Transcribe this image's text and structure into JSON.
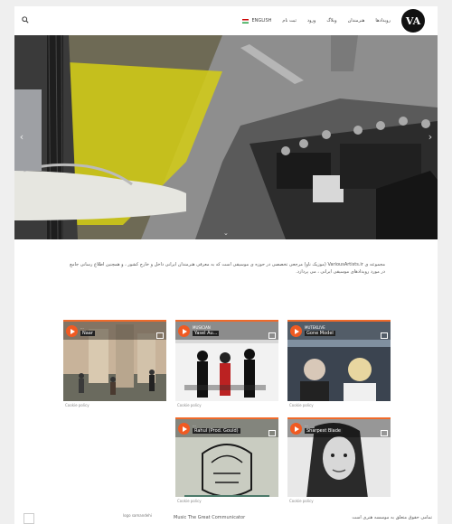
{
  "brand": {
    "logo_text": "VA"
  },
  "nav": {
    "items": [
      "رویدادها",
      "هنرمندان",
      "وبلاگ",
      "ورود",
      "ثبت نام"
    ],
    "language": "ENGLISH"
  },
  "intro": "مجموعه ی VariousArtists.ir (موزیک ناو) مرجعی تخصصی در حوزه ی موسیقی است که به معرفی هنرمندان ایرانی داخل و خارج کشور ، و همچنین اطلاع رسانی جامع در مورد رویدادهای موسیقی ایرانی ، می پردازد.",
  "cards": [
    {
      "subtitle": "...",
      "title": "Naar",
      "foot": "Cookie policy"
    },
    {
      "subtitle": "MUSICIAN",
      "title": "Yasel Au...",
      "foot": "Cookie policy"
    },
    {
      "subtitle": "MUTEKLIVE",
      "title": "Gone Model",
      "foot": "Cookie policy"
    },
    {
      "subtitle": "...",
      "title": "Rahul (Prod. Gould)",
      "foot": "Cookie policy"
    },
    {
      "subtitle": "...",
      "title": "Sharpest Blade",
      "foot": "Cookie policy"
    }
  ],
  "footer": {
    "left": "Music The Great Communicator",
    "right": "تمامی حقوق متعلق به موسسه هنری است",
    "logo_alt": "logo samandehi"
  },
  "colors": {
    "accent": "#f05a22",
    "hero_yellow": "#e0d40a"
  }
}
